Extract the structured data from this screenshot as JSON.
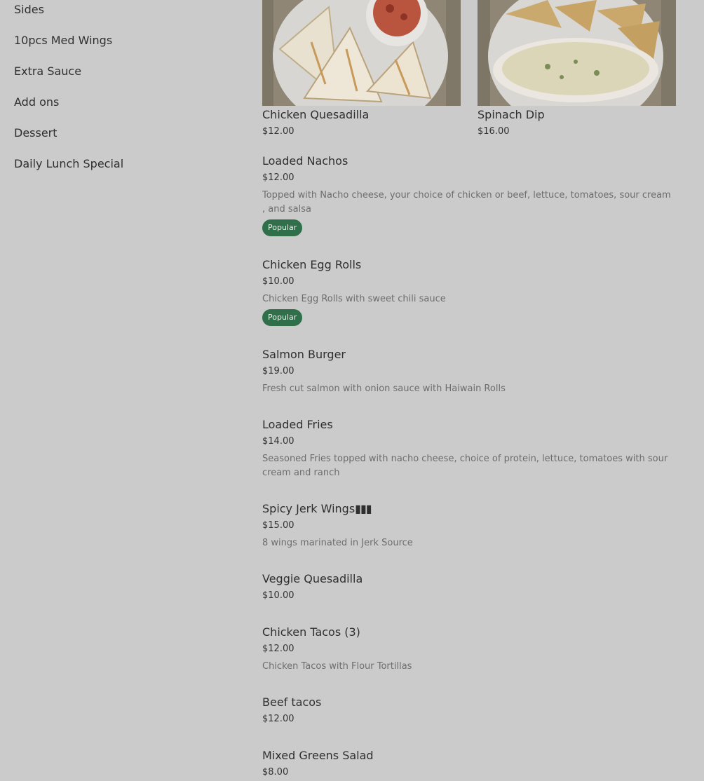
{
  "sidebar": {
    "categories": [
      "Sides",
      "10pcs Med Wings",
      "Extra Sauce",
      "Add ons",
      "Dessert",
      "Daily Lunch Special"
    ]
  },
  "featured": [
    {
      "name": "Chicken Quesadilla",
      "price": "$12.00",
      "image_icon": "quesadilla-photo"
    },
    {
      "name": "Spinach Dip",
      "price": "$16.00",
      "image_icon": "spinach-dip-photo"
    }
  ],
  "items": [
    {
      "name": "Loaded Nachos",
      "price": "$12.00",
      "description": "Topped with Nacho cheese, your choice of chicken or beef, lettuce, tomatoes, sour cream , and salsa",
      "badge": "Popular"
    },
    {
      "name": "Chicken Egg Rolls",
      "price": "$10.00",
      "description": "Chicken Egg Rolls with sweet chili sauce",
      "badge": "Popular"
    },
    {
      "name": "Salmon Burger",
      "price": "$19.00",
      "description": "Fresh cut salmon with onion sauce with Haiwain Rolls"
    },
    {
      "name": "Loaded Fries",
      "price": "$14.00",
      "description": "Seasoned Fries topped with nacho cheese, choice of protein, lettuce, tomatoes with sour cream and ranch"
    },
    {
      "name": "Spicy Jerk Wings",
      "name_suffix_glyphs": "▮▮▮",
      "price": "$15.00",
      "description": "8 wings marinated in Jerk Source"
    },
    {
      "name": "Veggie Quesadilla",
      "price": "$10.00"
    },
    {
      "name": "Chicken Tacos (3)",
      "price": "$12.00",
      "description": "Chicken Tacos with Flour Tortillas"
    },
    {
      "name": "Beef tacos",
      "price": "$12.00"
    },
    {
      "name": "Mixed Greens Salad",
      "price": "$8.00"
    }
  ],
  "colors": {
    "background_overlay": "#cbcbcb",
    "badge": "#2f6f4a",
    "description_text": "#6d6d6d"
  }
}
